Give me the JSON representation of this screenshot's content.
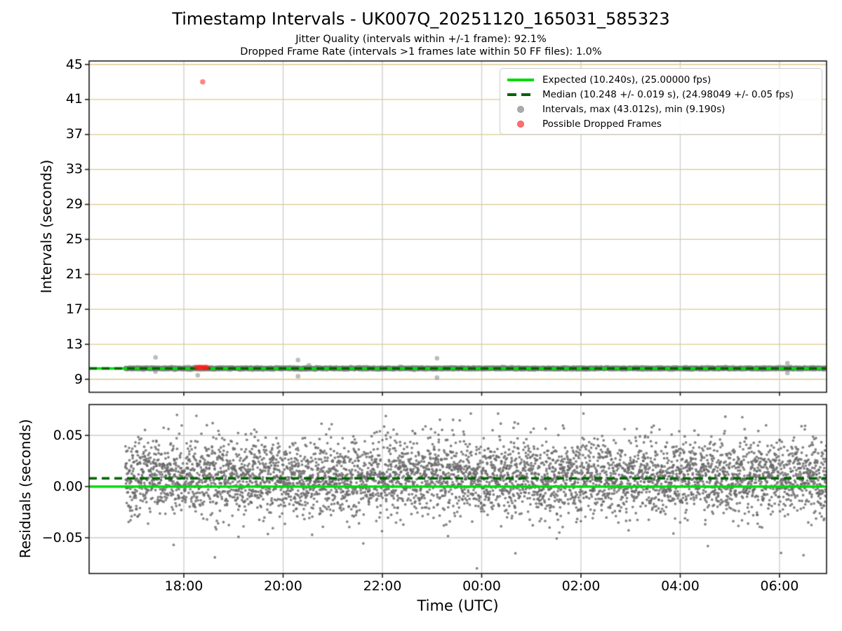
{
  "figure": {
    "title": "Timestamp Intervals - UK007Q_20251120_165031_585323",
    "subtitle_line1": "Jitter Quality (intervals within +/-1 frame): 92.1%",
    "subtitle_line2": "Dropped Frame Rate (intervals >1 frames late within 50 FF files): 1.0%"
  },
  "colors": {
    "expected_line": "#00dc0a",
    "median_line": "#006400",
    "intervals_marker": "#808080",
    "dropped_marker": "#ff1e1e",
    "hgrid_top": "#dcc98e",
    "grid_gray": "#cdcdcd",
    "spine": "#1a1a1a",
    "text": "#000000"
  },
  "chart_data": [
    {
      "type": "scatter",
      "name": "timestamp-intervals",
      "ylabel": "Intervals (seconds)",
      "ylim": [
        7.5,
        45.4
      ],
      "yticks": [
        9,
        13,
        17,
        21,
        25,
        29,
        33,
        37,
        41,
        45
      ],
      "grid": true,
      "legend_position": "upper right",
      "x_hours_utc": {
        "lim": [
          16.09,
          30.95
        ],
        "ticks": [
          18,
          20,
          22,
          24,
          26,
          28,
          30
        ],
        "tick_labels": [
          "18:00",
          "20:00",
          "22:00",
          "00:00",
          "02:00",
          "04:00",
          "06:00"
        ]
      },
      "expected": {
        "value": 10.24,
        "fps": 25.0,
        "label": "Expected (10.240s), (25.00000 fps)"
      },
      "median": {
        "value": 10.248,
        "value_err": 0.019,
        "fps": 24.98049,
        "fps_err": 0.05,
        "label": "Median (10.248 +/- 0.019 s), (24.98049 +/- 0.05 fps)"
      },
      "intervals": {
        "label": "Intervals, max (43.012s), min (9.190s)",
        "max_s": 43.012,
        "min_s": 9.19,
        "dense_band": {
          "t_start": 16.82,
          "t_end": 30.95,
          "center": 10.248,
          "sigma": 0.055,
          "count": 4950
        },
        "outliers": [
          [
            17.43,
            11.5
          ],
          [
            17.43,
            9.88
          ],
          [
            18.28,
            9.46
          ],
          [
            20.3,
            11.2
          ],
          [
            20.3,
            9.35
          ],
          [
            20.52,
            10.6
          ],
          [
            23.1,
            11.4
          ],
          [
            23.1,
            9.19
          ],
          [
            30.16,
            10.85
          ],
          [
            30.16,
            9.72
          ]
        ]
      },
      "dropped": {
        "label": "Possible Dropped Frames",
        "points": [
          [
            18.38,
            43.012
          ],
          [
            18.26,
            10.36
          ],
          [
            18.29,
            10.33
          ],
          [
            18.32,
            10.38
          ],
          [
            18.35,
            10.34
          ],
          [
            18.38,
            10.36
          ],
          [
            18.41,
            10.32
          ],
          [
            18.44,
            10.37
          ],
          [
            18.47,
            10.34
          ]
        ]
      }
    },
    {
      "type": "scatter",
      "name": "residuals",
      "ylabel": "Residuals (seconds)",
      "xlabel": "Time (UTC)",
      "ylim": [
        -0.085,
        0.08
      ],
      "yticks": [
        0.05,
        0.0,
        -0.05
      ],
      "ytick_labels": [
        "0.05",
        "0.00",
        "−0.05"
      ],
      "grid": true,
      "expected_value": 0.0,
      "median_value": 0.008,
      "points_summary": {
        "t_start": 16.82,
        "t_end": 30.95,
        "count": 4950,
        "core_sigma": 0.018,
        "tail_fraction": 0.035,
        "tail_sigma": 0.034,
        "median_offset": 0.008,
        "clip": [
          -0.082,
          0.0715
        ]
      }
    }
  ]
}
